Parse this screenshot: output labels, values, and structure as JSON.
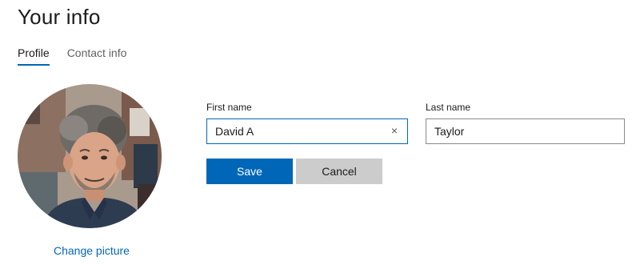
{
  "page": {
    "title": "Your info"
  },
  "tabs": [
    {
      "label": "Profile",
      "active": true
    },
    {
      "label": "Contact info",
      "active": false
    }
  ],
  "profile": {
    "avatar_icon": "profile-photo",
    "change_picture_label": "Change picture"
  },
  "form": {
    "first_name": {
      "label": "First name",
      "value": "David A"
    },
    "last_name": {
      "label": "Last name",
      "value": "Taylor"
    },
    "clear_glyph": "×",
    "save_label": "Save",
    "cancel_label": "Cancel"
  },
  "colors": {
    "accent": "#0067b8",
    "cancel_bg": "#cccccc"
  }
}
